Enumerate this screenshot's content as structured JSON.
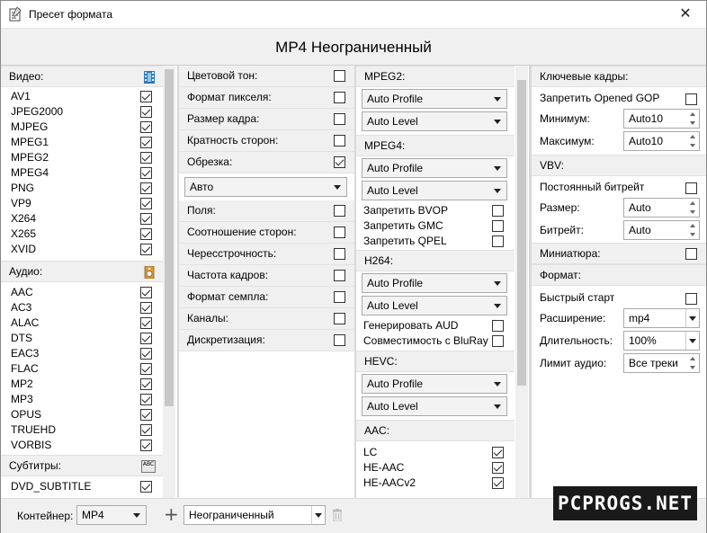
{
  "window": {
    "title": "Пресет формата",
    "close_glyph": "✕"
  },
  "header": {
    "title": "MP4 Неограниченный"
  },
  "video": {
    "label": "Видео:",
    "items": [
      {
        "name": "AV1",
        "checked": true
      },
      {
        "name": "JPEG2000",
        "checked": true
      },
      {
        "name": "MJPEG",
        "checked": true
      },
      {
        "name": "MPEG1",
        "checked": true
      },
      {
        "name": "MPEG2",
        "checked": true
      },
      {
        "name": "MPEG4",
        "checked": true
      },
      {
        "name": "PNG",
        "checked": true
      },
      {
        "name": "VP9",
        "checked": true
      },
      {
        "name": "X264",
        "checked": true
      },
      {
        "name": "X265",
        "checked": true
      },
      {
        "name": "XVID",
        "checked": true
      }
    ]
  },
  "audio": {
    "label": "Аудио:",
    "items": [
      {
        "name": "AAC",
        "checked": true
      },
      {
        "name": "AC3",
        "checked": true
      },
      {
        "name": "ALAC",
        "checked": true
      },
      {
        "name": "DTS",
        "checked": true
      },
      {
        "name": "EAC3",
        "checked": true
      },
      {
        "name": "FLAC",
        "checked": true
      },
      {
        "name": "MP2",
        "checked": true
      },
      {
        "name": "MP3",
        "checked": true
      },
      {
        "name": "OPUS",
        "checked": true
      },
      {
        "name": "TRUEHD",
        "checked": true
      },
      {
        "name": "VORBIS",
        "checked": true
      }
    ]
  },
  "subtitles": {
    "label": "Субтитры:",
    "icon_text": "ABC",
    "items": [
      {
        "name": "DVD_SUBTITLE",
        "checked": true
      }
    ]
  },
  "properties": {
    "rows": [
      {
        "label": "Цветовой тон:",
        "checked": false
      },
      {
        "label": "Формат пикселя:",
        "checked": false
      },
      {
        "label": "Размер кадра:",
        "checked": false
      },
      {
        "label": "Кратность сторон:",
        "checked": false
      },
      {
        "label": "Обрезка:",
        "checked": true
      }
    ],
    "crop_value": "Авто",
    "rows2": [
      {
        "label": "Поля:",
        "checked": false
      },
      {
        "label": "Соотношение сторон:",
        "checked": false
      },
      {
        "label": "Чересстрочность:",
        "checked": false
      },
      {
        "label": "Частота кадров:",
        "checked": false
      },
      {
        "label": "Формат семпла:",
        "checked": false
      },
      {
        "label": "Каналы:",
        "checked": false
      },
      {
        "label": "Дискретизация:",
        "checked": false
      }
    ]
  },
  "codecs": {
    "mpeg2": {
      "label": "MPEG2:",
      "profile": "Auto Profile",
      "level": "Auto Level"
    },
    "mpeg4": {
      "label": "MPEG4:",
      "profile": "Auto Profile",
      "level": "Auto Level",
      "options": [
        {
          "label": "Запретить BVOP",
          "checked": false
        },
        {
          "label": "Запретить GMC",
          "checked": false
        },
        {
          "label": "Запретить QPEL",
          "checked": false
        }
      ]
    },
    "h264": {
      "label": "H264:",
      "profile": "Auto Profile",
      "level": "Auto Level",
      "options": [
        {
          "label": "Генерировать AUD",
          "checked": false
        },
        {
          "label": "Совместимость с BluRay",
          "checked": false
        }
      ]
    },
    "hevc": {
      "label": "HEVC:",
      "profile": "Auto Profile",
      "level": "Auto Level"
    },
    "aac": {
      "label": "AAC:",
      "options": [
        {
          "label": "LC",
          "checked": true
        },
        {
          "label": "HE-AAC",
          "checked": true
        },
        {
          "label": "HE-AACv2",
          "checked": true
        }
      ]
    }
  },
  "keyframes": {
    "label": "Ключевые кадры:",
    "gop_label": "Запретить Opened GOP",
    "min_label": "Минимум:",
    "min_value": "Auto10",
    "max_label": "Максимум:",
    "max_value": "Auto10"
  },
  "vbv": {
    "label": "VBV:",
    "cbr_label": "Постоянный битрейт",
    "size_label": "Размер:",
    "size_value": "Auto",
    "bitrate_label": "Битрейт:",
    "bitrate_value": "Auto"
  },
  "thumbnail": {
    "label": "Миниатюра:"
  },
  "format": {
    "label": "Формат:",
    "faststart_label": "Быстрый старт",
    "ext_label": "Расширение:",
    "ext_value": "mp4",
    "duration_label": "Длительность:",
    "duration_value": "100%",
    "audio_limit_label": "Лимит аудио:",
    "audio_limit_value": "Все треки"
  },
  "footer": {
    "container_label": "Контейнер:",
    "container_value": "MP4",
    "plus_glyph": "+",
    "preset_value": "Неограниченный"
  },
  "watermark": "PCPROGS.NET"
}
